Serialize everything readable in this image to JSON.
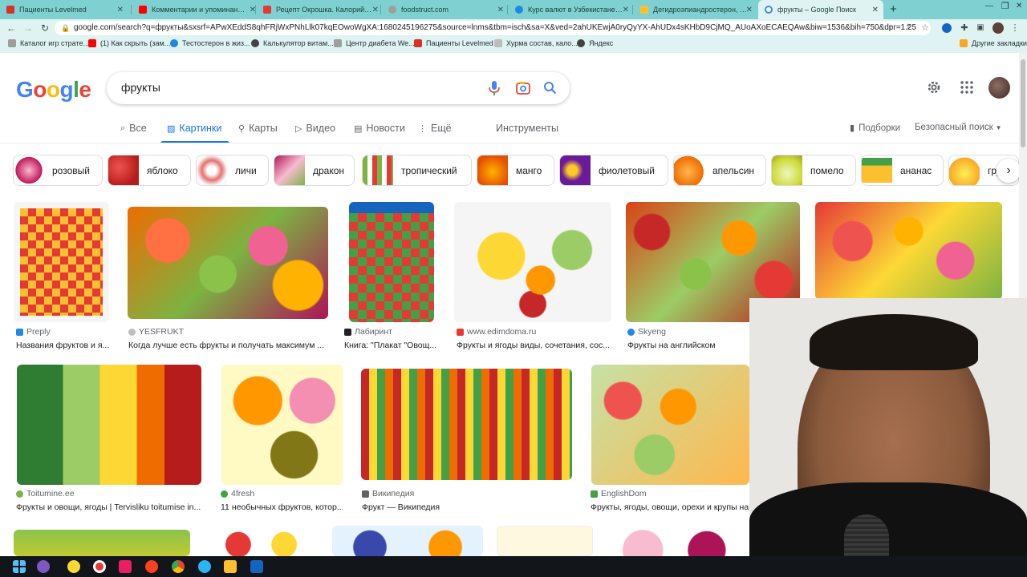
{
  "tabs": [
    {
      "label": "Пациенты Levelmed",
      "color": "#d93025"
    },
    {
      "label": "Комментарии и упоминания -",
      "color": "#ff0000"
    },
    {
      "label": "Рецепт Окрошка. Калорийнос",
      "color": "#e53935"
    },
    {
      "label": "foodstruct.com",
      "color": "#9e9e9e"
    },
    {
      "label": "Курс валют в Узбекистане. Лу",
      "color": "#1e88e5"
    },
    {
      "label": "Дегидроэпиандростерон, DHE",
      "color": "#fbc02d"
    },
    {
      "label": "фрукты – Google Поиск",
      "color": "#4285f4"
    }
  ],
  "toolbar": {
    "url": "google.com/search?q=фрукты&sxsrf=APwXEddS8qhFRjWxPNhLlk07kqEOwoWgXA:1680245196275&source=lnms&tbm=isch&sa=X&ved=2ahUKEwjA0ryQyYX-AhUDx4sKHbD9CjMQ_AUoAXoECAEQAw&biw=1536&bih=750&dpr=1.25"
  },
  "bookmarks": [
    {
      "label": "Каталог игр страте...",
      "color": "#9e9e9e"
    },
    {
      "label": "(1) Как скрыть (зам...",
      "color": "#ff0000"
    },
    {
      "label": "Тестостерон в жиз...",
      "color": "#1e88e5"
    },
    {
      "label": "Калькулятор витам...",
      "color": "#424242"
    },
    {
      "label": "Центр диабета We...",
      "color": "#9e9e9e"
    },
    {
      "label": "Пациенты Levelmed",
      "color": "#d93025"
    },
    {
      "label": "Хурма состав, кало...",
      "color": "#bdbdbd"
    },
    {
      "label": "Яндекс",
      "color": "#424242"
    },
    {
      "label": "Другие закладки",
      "color": "#f9a825"
    }
  ],
  "google": {
    "logo": "Google",
    "query": "фрукты"
  },
  "nav": {
    "items": [
      "Все",
      "Картинки",
      "Карты",
      "Видео",
      "Новости",
      "Ещё"
    ],
    "tools": "Инструменты",
    "collections": "Подборки",
    "safesearch": "Безопасный поиск"
  },
  "chips": [
    {
      "label": "розовый",
      "color": "#c2185b"
    },
    {
      "label": "яблоко",
      "color": "#c62828"
    },
    {
      "label": "личи",
      "color": "#e57373"
    },
    {
      "label": "дракон",
      "color": "#ad1457"
    },
    {
      "label": "тропический",
      "color": "#7cb342"
    },
    {
      "label": "манго",
      "color": "#fb8c00"
    },
    {
      "label": "фиолетовый",
      "color": "#6a1b9a"
    },
    {
      "label": "апельсин",
      "color": "#ef6c00"
    },
    {
      "label": "помело",
      "color": "#cddc39"
    },
    {
      "label": "ананас",
      "color": "#fbc02d"
    },
    {
      "label": "груша",
      "color": "#fdd835"
    }
  ],
  "results": [
    {
      "source": "Preply",
      "title": "Названия фруктов и я...",
      "src_color": "#1e88e5"
    },
    {
      "source": "YESFRUKT",
      "title": "Когда лучше есть фрукты и получать максимум ...",
      "src_color": "#bdbdbd"
    },
    {
      "source": "Лабиринт",
      "title": "Книга: \"Плакат \"Овощ...",
      "src_color": "#212121"
    },
    {
      "source": "www.edimdoma.ru",
      "title": "Фрукты и ягоды виды, сочетания, сос...",
      "src_color": "#e53935"
    },
    {
      "source": "Skyeng",
      "title": "Фрукты на английском",
      "src_color": "#1e88e5"
    },
    {
      "source": "Toitumine.ee",
      "title": "Фрукты и овощи, ягоды | Tervisliku toitumise in...",
      "src_color": "#7cb342"
    },
    {
      "source": "4fresh",
      "title": "11 необычных фруктов, котор...",
      "src_color": "#43a047"
    },
    {
      "source": "Википедия",
      "title": "Фрукт — Википедия",
      "src_color": "#616161"
    },
    {
      "source": "EnglishDom",
      "title": "Фрукты, ягоды, овощи, орехи и крупы на",
      "src_color": "#43a047"
    }
  ]
}
